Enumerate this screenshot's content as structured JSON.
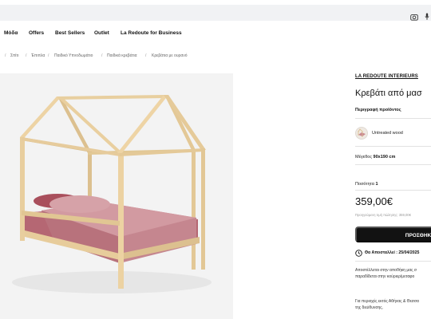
{
  "nav": {
    "items": [
      "Μόδα",
      "Offers",
      "Best Sellers",
      "Outlet",
      "La Redoute for Business"
    ]
  },
  "breadcrumb": {
    "items": [
      "Σπίτι",
      "Έπιπλα",
      "Παιδικό Υπνοδωμάτιο",
      "Παιδικά κρεβάτια",
      "Κρεβάτια με ουρανό"
    ]
  },
  "product": {
    "brand": "LA REDOUTE INTERIEURS",
    "title": "Κρεβάτι από μασ",
    "description_link": "Περιγραφή προϊόντος",
    "color_name": "Untreated wood",
    "size_label": "Μέγεθος",
    "size_value": "90x190 cm",
    "quantity_label": "Ποσότητα",
    "quantity_value": "1",
    "price": "359,00€",
    "previous_price": "Προηγούμενη τιμή πώλησης: 359,00€",
    "cta_label": "ΠΡΟΣΘΗΚ",
    "shipping_text": "Θα Αποσταλλεί : 25/04/2025",
    "info1_line1": "Αποστέλλεται στην αποθήκη μας σ",
    "info1_line2": "παραδίδεται στην κούριερ/μεταφο",
    "info2_line1": "Για περιοχές εκτός Αθήνας & Θεσσα",
    "info2_line2": "της διεύθυνσης."
  },
  "colors": {
    "cta_bg": "#121212",
    "gallery_bg": "#f3f3f3",
    "search_bg": "#f1f2f4",
    "wood": "#e6cb9c",
    "bedding": "#b76a76"
  },
  "icons": {
    "top_right": [
      "camera-icon",
      "microphone-icon"
    ],
    "shipping": "clock-icon"
  }
}
